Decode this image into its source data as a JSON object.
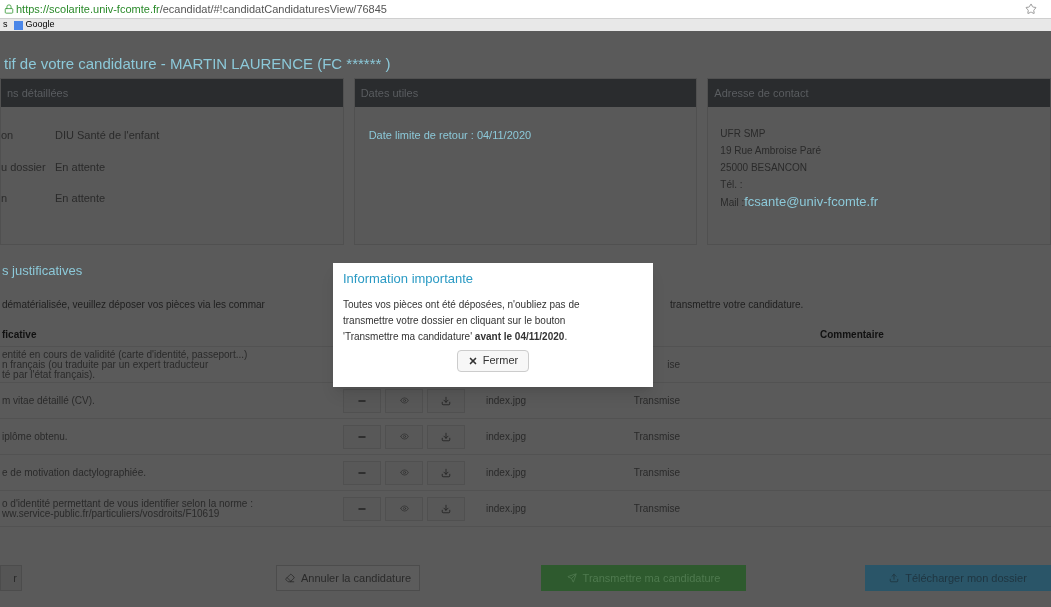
{
  "browser": {
    "url_host": "https://scolarite.univ-fcomte.fr",
    "url_path": "/ecandidat/#!candidatCandidaturesView/76845",
    "bookmarks": [
      {
        "label": "s"
      },
      {
        "label": "Google"
      }
    ]
  },
  "page_title": "tif de votre candidature - MARTIN  LAURENCE (FC ******   )",
  "panels": [
    {
      "kind": "details",
      "header": "ns détaillées",
      "rows": [
        {
          "label": "on",
          "value": "DIU Santé de l'enfant"
        },
        {
          "label": "u dossier",
          "value": "En attente"
        },
        {
          "label": "n",
          "value": "En attente"
        }
      ]
    },
    {
      "kind": "dates",
      "header": "Dates utiles",
      "lines": [
        "Date limite de retour : 04/11/2020"
      ]
    },
    {
      "kind": "address",
      "header": "Adresse de contact",
      "lines": [
        "UFR SMP",
        "19 Rue Ambroise Paré",
        "25000 BESANCON",
        "Tél. :"
      ],
      "mail_label": "Mail : ",
      "mail": "fcsante@univ-fcomte.fr"
    }
  ],
  "section_title": "s justificatives",
  "instructions": [
    "dématérialisée, veuillez déposer vos pièces via les commar",
    "transmettre votre candidature."
  ],
  "table": {
    "columns": [
      "ficative",
      "Commentaire"
    ],
    "rows": [
      {
        "lines": [
          "entité en cours de validité (carte d'identité, passeport...)",
          "n français (ou traduite par un expert traducteur",
          "té par l'état français)."
        ],
        "status": "ise"
      },
      {
        "lines": [
          "m vitae détaillé (CV)."
        ],
        "file": "index.jpg",
        "status": "Transmise"
      },
      {
        "lines": [
          "iplôme obtenu."
        ],
        "file": "index.jpg",
        "status": "Transmise"
      },
      {
        "lines": [
          "e de motivation dactylographiée."
        ],
        "file": "index.jpg",
        "status": "Transmise"
      },
      {
        "lines": [
          "o d'identité permettant de vous identifier selon la norme :",
          "ww.service-public.fr/particuliers/vosdroits/F10619"
        ],
        "file": "index.jpg",
        "status": "Transmise"
      }
    ]
  },
  "footer_buttons": [
    {
      "kind": "cut",
      "label": "r"
    },
    {
      "kind": "default",
      "label": "Annuler la candidature"
    },
    {
      "kind": "success",
      "label": "Transmettre ma candidature"
    },
    {
      "kind": "info",
      "label": "Télécharger mon dossier"
    }
  ],
  "modal": {
    "title": "Information importante",
    "body": "Toutes vos pièces ont été déposées, n'oubliez pas de transmettre votre dossier en cliquant sur le bouton 'Transmettre ma candidature' **avant le 04/11/2020**.",
    "button": "Fermer"
  }
}
